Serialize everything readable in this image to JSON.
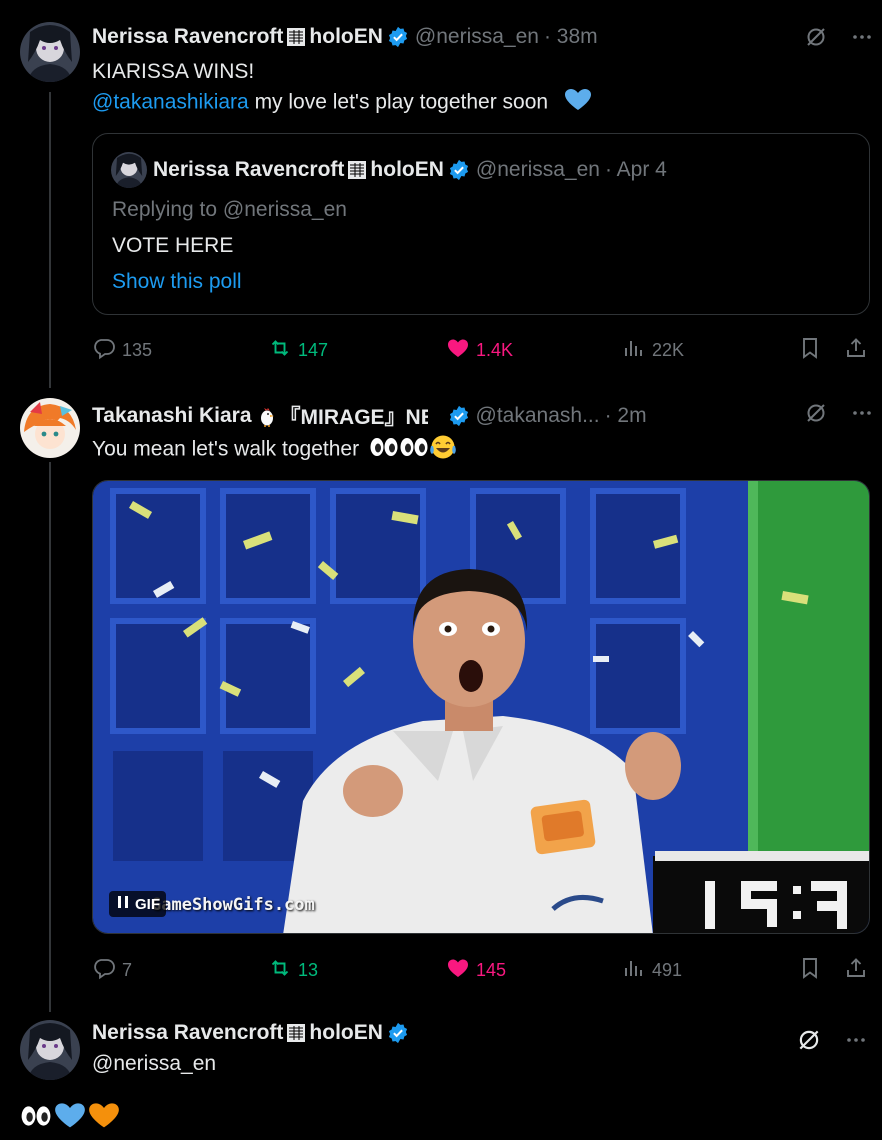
{
  "colors": {
    "accent": "#1d9bf0",
    "retweet": "#00ba7c",
    "like": "#f91880",
    "muted": "#71767b",
    "border": "#2f3336"
  },
  "tweets": [
    {
      "author_name": "Nerissa Ravencroft",
      "author_suffix": "holoEN",
      "handle": "@nerissa_en",
      "time": "· 38m",
      "line1": "KIARISSA WINS!",
      "mention": "@takanashikiara",
      "line2_rest": " my love let's play together soon",
      "line2_emoji": "blue-heart-icon",
      "quote": {
        "author_name": "Nerissa Ravencroft",
        "author_suffix": "holoEN",
        "handle": "@nerissa_en",
        "time": "· Apr 4",
        "replying_to": "Replying to @nerissa_en",
        "body": "VOTE HERE",
        "poll_link": "Show this poll"
      },
      "stats": {
        "replies": "135",
        "retweets": "147",
        "likes": "1.4K",
        "views": "22K"
      }
    },
    {
      "author_name": "Takanashi Kiara",
      "author_suffix": "『MIRAGE』NEW SON...",
      "handle": "@takanash...",
      "time": "· 2m",
      "body": "You mean let's walk together",
      "media": {
        "badge": "GIF",
        "watermark": "GameShowGifs.com"
      },
      "stats": {
        "replies": "7",
        "retweets": "13",
        "likes": "145",
        "views": "491"
      }
    },
    {
      "author_name": "Nerissa Ravencroft",
      "author_suffix": "holoEN",
      "handle": "@nerissa_en",
      "body_emojis": [
        "eyes-icon",
        "blue-heart-icon",
        "orange-heart-icon"
      ]
    }
  ]
}
